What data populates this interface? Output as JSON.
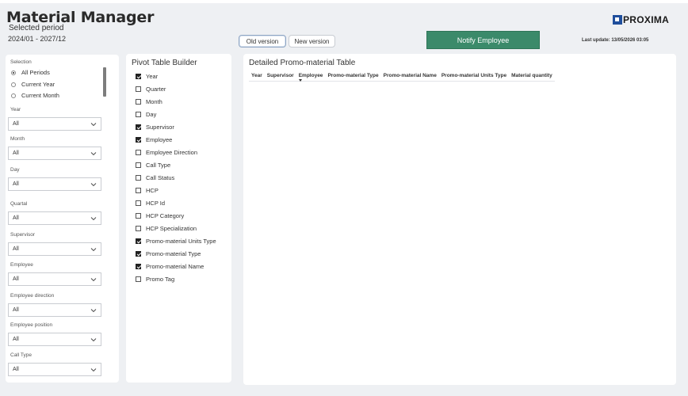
{
  "header": {
    "title": "Material Manager",
    "selected_period_label": "Selected period",
    "selected_period_value": "2024/01 - 2027/12",
    "old_version_label": "Old version",
    "new_version_label": "New version",
    "notify_label": "Notify Employee",
    "last_update": "Last update: 13/05/2026 03:05",
    "logo_text": "PROXIMA"
  },
  "filters": {
    "selection_label": "Selection",
    "selection_options": [
      "All Periods",
      "Current Year",
      "Current Month"
    ],
    "selected_option": "All Periods",
    "dropdowns": [
      {
        "label": "Year",
        "value": "All"
      },
      {
        "label": "Month",
        "value": "All"
      },
      {
        "label": "Day",
        "value": "All"
      },
      {
        "label": "Quartal",
        "value": "All"
      },
      {
        "label": "Supervisor",
        "value": "All"
      },
      {
        "label": "Employee",
        "value": "All"
      },
      {
        "label": "Employee direction",
        "value": "All"
      },
      {
        "label": "Employee position",
        "value": "All"
      },
      {
        "label": "Call Type",
        "value": "All"
      }
    ]
  },
  "builder": {
    "title": "Pivot Table Builder",
    "items": [
      {
        "label": "Year",
        "checked": true
      },
      {
        "label": "Quarter",
        "checked": false
      },
      {
        "label": "Month",
        "checked": false
      },
      {
        "label": "Day",
        "checked": false
      },
      {
        "label": "Supervisor",
        "checked": true
      },
      {
        "label": "Employee",
        "checked": true
      },
      {
        "label": "Employee Direction",
        "checked": false
      },
      {
        "label": "Call Type",
        "checked": false
      },
      {
        "label": "Call Status",
        "checked": false
      },
      {
        "label": "HCP",
        "checked": false
      },
      {
        "label": "HCP Id",
        "checked": false
      },
      {
        "label": "HCP Category",
        "checked": false
      },
      {
        "label": "HCP Specialization",
        "checked": false
      },
      {
        "label": "Promo-material Units Type",
        "checked": true
      },
      {
        "label": "Promo-material Type",
        "checked": true
      },
      {
        "label": "Promo-material Name",
        "checked": true
      },
      {
        "label": "Promo Tag",
        "checked": false
      }
    ]
  },
  "table": {
    "title": "Detailed Promo-material Table",
    "columns": [
      "Year",
      "Supervisor",
      "Employee",
      "Promo-material Type",
      "Promo-material Name",
      "Promo-material Units Type",
      "Material quantity"
    ]
  },
  "colors": {
    "accent_green": "#3b8a6a",
    "logo_blue": "#1f4e9c",
    "background": "#eef0f3"
  }
}
